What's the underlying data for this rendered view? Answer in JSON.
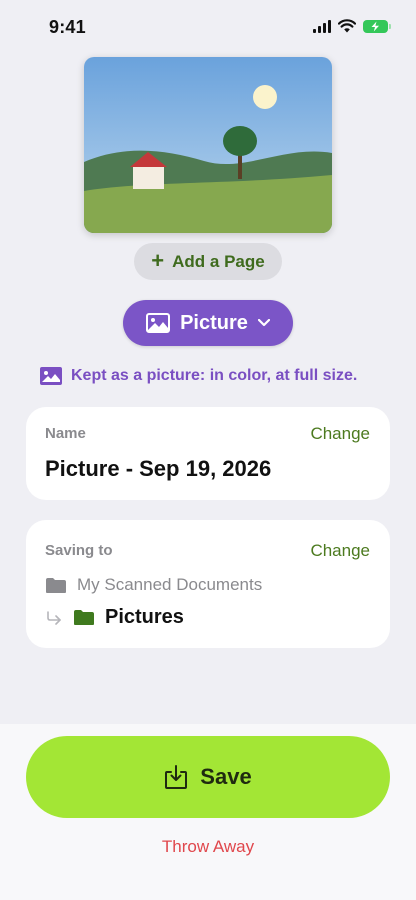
{
  "status_bar": {
    "time": "9:41"
  },
  "preview": {
    "alt": "scanned picture preview"
  },
  "add_page_label": "Add a Page",
  "type_selector": {
    "label": "Picture"
  },
  "hint": "Kept as a picture: in color, at full size.",
  "name_card": {
    "label": "Name",
    "change_label": "Change",
    "value": "Picture - Sep 19, 2026"
  },
  "saving_card": {
    "label": "Saving to",
    "change_label": "Change",
    "parent_folder": "My Scanned Documents",
    "folder": "Pictures"
  },
  "save_label": "Save",
  "throw_away_label": "Throw Away",
  "colors": {
    "accent_green": "#a3e635",
    "purple": "#7b55c7",
    "change_green": "#4c7a1f",
    "destructive": "#e0474c"
  }
}
